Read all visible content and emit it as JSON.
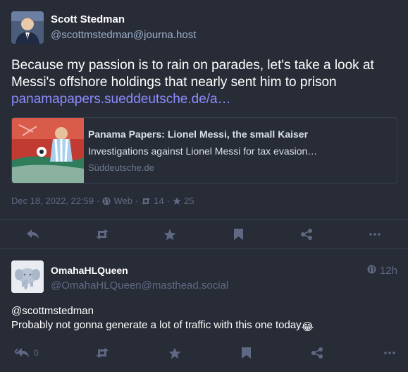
{
  "main_status": {
    "display_name": "Scott Stedman",
    "account": "@scottmstedman@journa.host",
    "content_text": "Because my passion is to rain on parades, let's take a look at Messi's offshore holdings that nearly sent him to prison",
    "content_link": "panamapapers.sueddeutsche.de/a…",
    "card": {
      "title": "Panama Papers: Lionel Messi, the small Kaiser",
      "description": "Investigations against Lionel Messi for tax evasion…",
      "host": "Süddeutsche.de"
    },
    "meta": {
      "timestamp": "Dec 18, 2022, 22:59",
      "separator": "·",
      "visibility_icon": "globe-icon",
      "visibility_label": "Web",
      "boost_icon": "retweet-icon",
      "boost_count": "14",
      "fav_icon": "star-icon",
      "fav_count": "25"
    },
    "actions": [
      "reply-icon",
      "boost-icon",
      "favourite-icon",
      "bookmark-icon",
      "share-icon",
      "more-icon"
    ]
  },
  "reply_status": {
    "display_name": "OmahaHLQueen",
    "account": "@OmahaHLQueen@masthead.social",
    "time_ago": "12h",
    "mention": "@scottmstedman",
    "text": "Probably not gonna generate a lot of traffic with this one today",
    "emoji": "😂",
    "reply_count": "0",
    "actions": [
      "reply-all-icon",
      "boost-icon",
      "favourite-icon",
      "bookmark-icon",
      "share-icon",
      "more-icon"
    ]
  },
  "colors": {
    "background": "#282c37",
    "link": "#8c8dff",
    "muted": "#606984",
    "secondary": "#9baec8",
    "divider": "#393f4f"
  }
}
